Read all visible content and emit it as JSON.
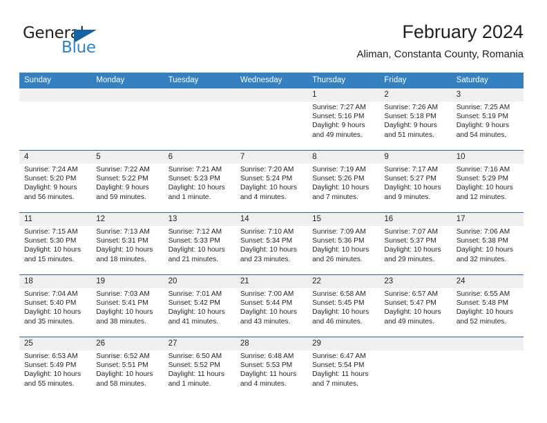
{
  "brand": {
    "name_part1": "General",
    "name_part2": "Blue",
    "triangle_color": "#1464a5",
    "blue_text_color": "#2e83c7"
  },
  "header": {
    "title": "February 2024",
    "subtitle": "Aliman, Constanta County, Romania"
  },
  "theme": {
    "header_bg": "#3580c0",
    "week_divider": "#1d65a6",
    "daynum_bg": "#efefef",
    "text": "#231f20"
  },
  "weekday_headers": [
    "Sunday",
    "Monday",
    "Tuesday",
    "Wednesday",
    "Thursday",
    "Friday",
    "Saturday"
  ],
  "weeks": [
    [
      {
        "day": "",
        "sunrise": "",
        "sunset": "",
        "daylight": ""
      },
      {
        "day": "",
        "sunrise": "",
        "sunset": "",
        "daylight": ""
      },
      {
        "day": "",
        "sunrise": "",
        "sunset": "",
        "daylight": ""
      },
      {
        "day": "",
        "sunrise": "",
        "sunset": "",
        "daylight": ""
      },
      {
        "day": "1",
        "sunrise": "Sunrise: 7:27 AM",
        "sunset": "Sunset: 5:16 PM",
        "daylight": "Daylight: 9 hours and 49 minutes."
      },
      {
        "day": "2",
        "sunrise": "Sunrise: 7:26 AM",
        "sunset": "Sunset: 5:18 PM",
        "daylight": "Daylight: 9 hours and 51 minutes."
      },
      {
        "day": "3",
        "sunrise": "Sunrise: 7:25 AM",
        "sunset": "Sunset: 5:19 PM",
        "daylight": "Daylight: 9 hours and 54 minutes."
      }
    ],
    [
      {
        "day": "4",
        "sunrise": "Sunrise: 7:24 AM",
        "sunset": "Sunset: 5:20 PM",
        "daylight": "Daylight: 9 hours and 56 minutes."
      },
      {
        "day": "5",
        "sunrise": "Sunrise: 7:22 AM",
        "sunset": "Sunset: 5:22 PM",
        "daylight": "Daylight: 9 hours and 59 minutes."
      },
      {
        "day": "6",
        "sunrise": "Sunrise: 7:21 AM",
        "sunset": "Sunset: 5:23 PM",
        "daylight": "Daylight: 10 hours and 1 minute."
      },
      {
        "day": "7",
        "sunrise": "Sunrise: 7:20 AM",
        "sunset": "Sunset: 5:24 PM",
        "daylight": "Daylight: 10 hours and 4 minutes."
      },
      {
        "day": "8",
        "sunrise": "Sunrise: 7:19 AM",
        "sunset": "Sunset: 5:26 PM",
        "daylight": "Daylight: 10 hours and 7 minutes."
      },
      {
        "day": "9",
        "sunrise": "Sunrise: 7:17 AM",
        "sunset": "Sunset: 5:27 PM",
        "daylight": "Daylight: 10 hours and 9 minutes."
      },
      {
        "day": "10",
        "sunrise": "Sunrise: 7:16 AM",
        "sunset": "Sunset: 5:29 PM",
        "daylight": "Daylight: 10 hours and 12 minutes."
      }
    ],
    [
      {
        "day": "11",
        "sunrise": "Sunrise: 7:15 AM",
        "sunset": "Sunset: 5:30 PM",
        "daylight": "Daylight: 10 hours and 15 minutes."
      },
      {
        "day": "12",
        "sunrise": "Sunrise: 7:13 AM",
        "sunset": "Sunset: 5:31 PM",
        "daylight": "Daylight: 10 hours and 18 minutes."
      },
      {
        "day": "13",
        "sunrise": "Sunrise: 7:12 AM",
        "sunset": "Sunset: 5:33 PM",
        "daylight": "Daylight: 10 hours and 21 minutes."
      },
      {
        "day": "14",
        "sunrise": "Sunrise: 7:10 AM",
        "sunset": "Sunset: 5:34 PM",
        "daylight": "Daylight: 10 hours and 23 minutes."
      },
      {
        "day": "15",
        "sunrise": "Sunrise: 7:09 AM",
        "sunset": "Sunset: 5:36 PM",
        "daylight": "Daylight: 10 hours and 26 minutes."
      },
      {
        "day": "16",
        "sunrise": "Sunrise: 7:07 AM",
        "sunset": "Sunset: 5:37 PM",
        "daylight": "Daylight: 10 hours and 29 minutes."
      },
      {
        "day": "17",
        "sunrise": "Sunrise: 7:06 AM",
        "sunset": "Sunset: 5:38 PM",
        "daylight": "Daylight: 10 hours and 32 minutes."
      }
    ],
    [
      {
        "day": "18",
        "sunrise": "Sunrise: 7:04 AM",
        "sunset": "Sunset: 5:40 PM",
        "daylight": "Daylight: 10 hours and 35 minutes."
      },
      {
        "day": "19",
        "sunrise": "Sunrise: 7:03 AM",
        "sunset": "Sunset: 5:41 PM",
        "daylight": "Daylight: 10 hours and 38 minutes."
      },
      {
        "day": "20",
        "sunrise": "Sunrise: 7:01 AM",
        "sunset": "Sunset: 5:42 PM",
        "daylight": "Daylight: 10 hours and 41 minutes."
      },
      {
        "day": "21",
        "sunrise": "Sunrise: 7:00 AM",
        "sunset": "Sunset: 5:44 PM",
        "daylight": "Daylight: 10 hours and 43 minutes."
      },
      {
        "day": "22",
        "sunrise": "Sunrise: 6:58 AM",
        "sunset": "Sunset: 5:45 PM",
        "daylight": "Daylight: 10 hours and 46 minutes."
      },
      {
        "day": "23",
        "sunrise": "Sunrise: 6:57 AM",
        "sunset": "Sunset: 5:47 PM",
        "daylight": "Daylight: 10 hours and 49 minutes."
      },
      {
        "day": "24",
        "sunrise": "Sunrise: 6:55 AM",
        "sunset": "Sunset: 5:48 PM",
        "daylight": "Daylight: 10 hours and 52 minutes."
      }
    ],
    [
      {
        "day": "25",
        "sunrise": "Sunrise: 6:53 AM",
        "sunset": "Sunset: 5:49 PM",
        "daylight": "Daylight: 10 hours and 55 minutes."
      },
      {
        "day": "26",
        "sunrise": "Sunrise: 6:52 AM",
        "sunset": "Sunset: 5:51 PM",
        "daylight": "Daylight: 10 hours and 58 minutes."
      },
      {
        "day": "27",
        "sunrise": "Sunrise: 6:50 AM",
        "sunset": "Sunset: 5:52 PM",
        "daylight": "Daylight: 11 hours and 1 minute."
      },
      {
        "day": "28",
        "sunrise": "Sunrise: 6:48 AM",
        "sunset": "Sunset: 5:53 PM",
        "daylight": "Daylight: 11 hours and 4 minutes."
      },
      {
        "day": "29",
        "sunrise": "Sunrise: 6:47 AM",
        "sunset": "Sunset: 5:54 PM",
        "daylight": "Daylight: 11 hours and 7 minutes."
      },
      {
        "day": "",
        "sunrise": "",
        "sunset": "",
        "daylight": ""
      },
      {
        "day": "",
        "sunrise": "",
        "sunset": "",
        "daylight": ""
      }
    ]
  ]
}
